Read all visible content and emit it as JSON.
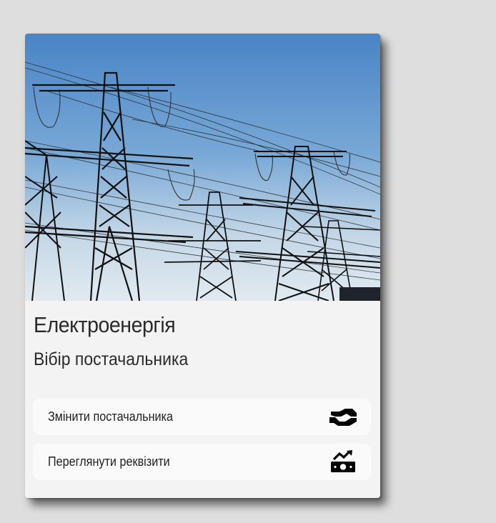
{
  "card": {
    "title": "Електроенергія",
    "subtitle": "Вібір постачальника",
    "image_icon": "power-lines-photo",
    "actions": [
      {
        "label": "Змінити постачальника",
        "icon": "handshake-icon"
      },
      {
        "label": "Переглянути реквізити",
        "icon": "money-growth-icon"
      }
    ]
  },
  "colors": {
    "page_background": "#dedede",
    "card_background": "#f3f3f3",
    "button_background": "#fafafa",
    "sky_top": "#4a86c8",
    "sky_bottom": "#dbe6ee",
    "text": "#2a2a2a"
  }
}
